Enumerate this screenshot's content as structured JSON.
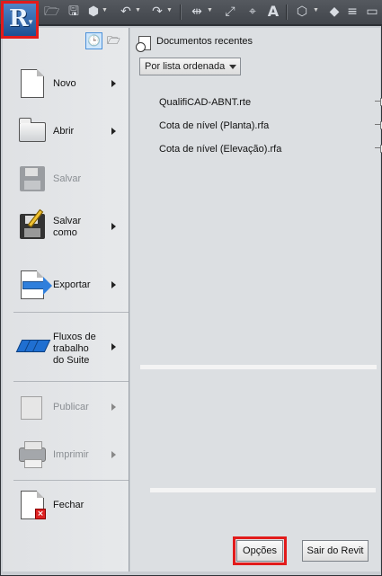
{
  "app": {
    "logo_letter": "R"
  },
  "toolbar": {
    "icons": [
      "open-icon",
      "save-icon",
      "sync-icon",
      "undo-icon",
      "redo-icon",
      "measure-icon",
      "dimension-icon",
      "tag-icon",
      "text-icon",
      "3d-view-icon",
      "section-icon",
      "thin-lines-icon",
      "switch-windows-icon"
    ],
    "text_glyph": "A"
  },
  "menu": {
    "items": [
      {
        "label": "Novo",
        "enabled": true,
        "has_submenu": true
      },
      {
        "label": "Abrir",
        "enabled": true,
        "has_submenu": true
      },
      {
        "label": "Salvar",
        "enabled": false,
        "has_submenu": false
      },
      {
        "label_line1": "Salvar",
        "label_line2": "como",
        "enabled": true,
        "has_submenu": true
      },
      {
        "label": "Exportar",
        "enabled": true,
        "has_submenu": true
      },
      {
        "label_line1": "Fluxos de",
        "label_line2": "trabalho",
        "label_line3": "do Suite",
        "enabled": true,
        "has_submenu": true
      },
      {
        "label": "Publicar",
        "enabled": false,
        "has_submenu": true
      },
      {
        "label": "Imprimir",
        "enabled": false,
        "has_submenu": true
      },
      {
        "label": "Fechar",
        "enabled": true,
        "has_submenu": false
      }
    ]
  },
  "recent": {
    "title": "Documentos recentes",
    "sort_select": "Por lista ordenada",
    "documents": [
      "QualifiCAD-ABNT.rte",
      "Cota de nível (Planta).rfa",
      "Cota de nível (Elevação).rfa"
    ]
  },
  "footer": {
    "options_label": "Opções",
    "exit_label": "Sair do Revit"
  },
  "colors": {
    "highlight": "#e21b1b",
    "accent": "#2f7fdc"
  }
}
